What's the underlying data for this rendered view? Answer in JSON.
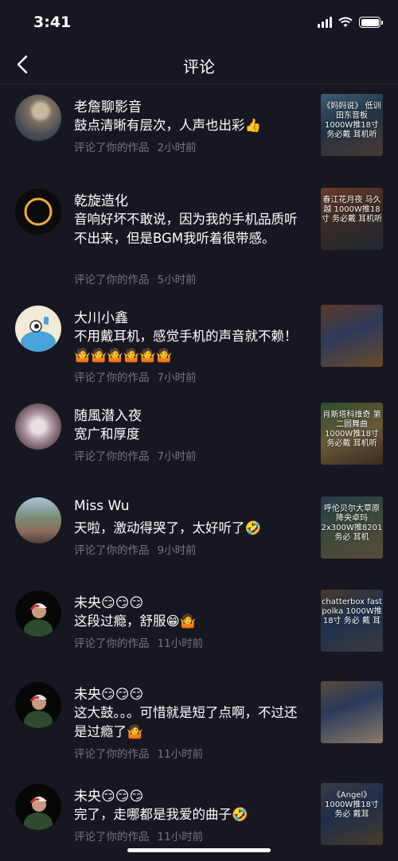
{
  "status": {
    "time": "3:41"
  },
  "nav": {
    "title": "评论"
  },
  "items": [
    {
      "name": "老詹聊影音",
      "comment": "鼓点清晰有层次，人声也出彩👍",
      "action": "评论了你的作品",
      "time": "2小时前",
      "thumb_text": "《妈妈说》 低训田东音板 1000W推18寸 务必戴 耳机听"
    },
    {
      "name": "乾旋造化",
      "comment": "音响好坏不敢说，因为我的手机品质听不出来，但是BGM我听着很带感。",
      "action": "评论了你的作品",
      "time": "5小时前",
      "thumb_text": "春江花月夜 马久越 1000W推18寸 务必戴 耳机听"
    },
    {
      "name": "大川小鑫",
      "comment": "不用戴耳机，感觉手机的声音就不赖！🤷🤷🤷🤷🤷🤷",
      "action": "评论了你的作品",
      "time": "7小时前",
      "thumb_text": ""
    },
    {
      "name": "随風潜入夜",
      "comment": "宽广和厚度",
      "action": "评论了你的作品",
      "time": "7小时前",
      "thumb_text": "肖斯塔科维奇 第二圆舞曲 1000W推18寸 务必戴 耳机听"
    },
    {
      "name": "Miss Wu",
      "comment": "天啦，激动得哭了，太好听了🤣",
      "action": "评论了你的作品",
      "time": "9小时前",
      "thumb_text": "呼伦贝尔大草原 降央卓玛 2x300W推8201 务必 耳机"
    },
    {
      "name": "未央😏😏😏",
      "comment": "这段过瘾，舒服😁🤷",
      "action": "评论了你的作品",
      "time": "11小时前",
      "thumb_text": "chatterbox fast polka 1000W推18寸 务必 戴 耳"
    },
    {
      "name": "未央😏😏😏",
      "comment": "这大鼓。。。可惜就是短了点啊，不过还是过瘾了🤷",
      "action": "评论了你的作品",
      "time": "11小时前",
      "thumb_text": ""
    },
    {
      "name": "未央😏😏😏",
      "comment": "完了，走哪都是我爱的曲子🤣",
      "action": "评论了你的作品",
      "time": "11小时前",
      "thumb_text": "《Angel》 1000W推18寸 务必 戴耳"
    }
  ]
}
